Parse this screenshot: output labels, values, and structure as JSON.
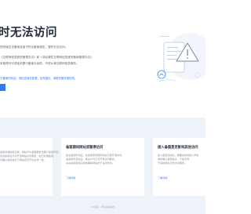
{
  "page": {
    "title": "时无法访问",
    "para1": "您的域名未备案或者不符合备案规定，暂时无法访问。",
    "para2": "《互联网信息服务管理办法》和《非经营性互联网信息服务备案管理办法》",
    "para3": "未取得许可或者未履行备案手续的，不得从事互联网信息服务。",
    "link_line": "已备案的网站，请检查域名配置；如有疑问，请联系服务提供商。",
    "button_label": ""
  },
  "cards": [
    {
      "title": "",
      "body": [
        "备案管理制度实施，网站开办者需要依法履行备案手续，",
        "完成备案后方可开通网站访问服务，如已办理备案，",
        "请确认备案信息与网站实际开办主体一致。"
      ],
      "link": ""
    },
    {
      "title": "备案期间网站须暂停访问",
      "body": [
        "提交备案申请后，在备案审核期间网站不能开通访问，",
        "备案审核通过后，网站方可正式开通访问服务。",
        "请在备案审核完成前确保网站处于关闭状态。"
      ],
      "link": "了解详情"
    },
    {
      "title": "接入备案是否影响其他访问",
      "body": [
        "接入备案完成后，需要在新的接入商处",
        "重新确认备案信息，不会影响",
        "已有的网站正常访问服务。"
      ],
      "link": "了解详情"
    }
  ],
  "footer": "ICP备案 · 网站备案服务"
}
